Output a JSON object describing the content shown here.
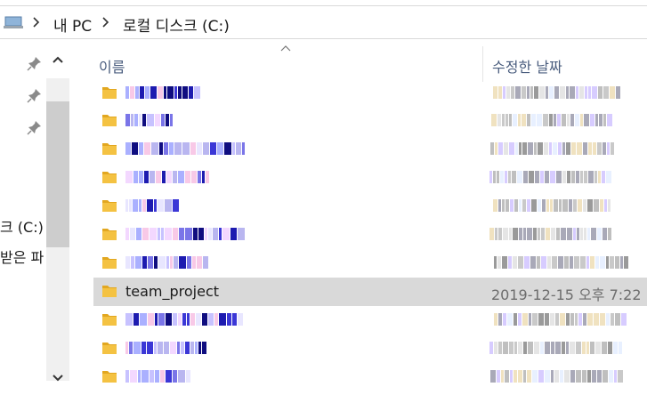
{
  "address": {
    "crumbs": [
      "내 PC",
      "로컬 디스크 (C:)"
    ]
  },
  "nav": {
    "labels": [
      "크 (C:)",
      "받은 파"
    ]
  },
  "columns": {
    "name": "이름",
    "date": "수정한 날짜"
  },
  "files": [
    {
      "name": "",
      "date": "",
      "obscured": true
    },
    {
      "name": "",
      "date": "",
      "obscured": true
    },
    {
      "name": "",
      "date": "",
      "obscured": true
    },
    {
      "name": "",
      "date": "",
      "obscured": true
    },
    {
      "name": "",
      "date": "",
      "obscured": true
    },
    {
      "name": "",
      "date": "",
      "obscured": true
    },
    {
      "name": "",
      "date": "",
      "obscured": true
    },
    {
      "name": "team_project",
      "date": "2019-12-15 오후 7:22",
      "obscured": false,
      "selected": true
    },
    {
      "name": "",
      "date": "",
      "obscured": true
    },
    {
      "name": "",
      "date": "",
      "obscured": true
    },
    {
      "name": "",
      "date": "",
      "obscured": true
    }
  ],
  "colors": {
    "folder": "#f4c242",
    "selected_row": "#d9d9d9",
    "header_text": "#4a5d7e"
  },
  "icons": [
    "pc-icon",
    "chevron-right-icon",
    "pin-icon",
    "scroll-up-icon",
    "scroll-down-icon",
    "sort-up-icon",
    "folder-icon"
  ]
}
